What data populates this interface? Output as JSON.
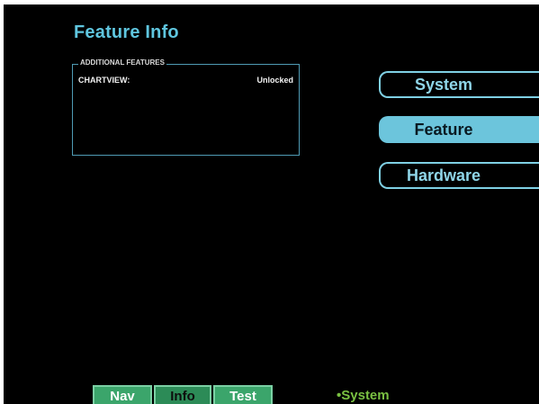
{
  "page": {
    "title": "Feature Info"
  },
  "additional_features": {
    "legend": "ADDITIONAL FEATURES",
    "items": [
      {
        "name": "CHARTVIEW:",
        "status": "Unlocked"
      }
    ]
  },
  "side_menu": {
    "system_label": "System",
    "feature_label": "Feature",
    "hardware_label": "Hardware",
    "active": "Feature"
  },
  "bottom_tabs": {
    "nav_label": "Nav",
    "info_label": "Info",
    "test_label": "Test",
    "active": "Info"
  },
  "status": {
    "text": "•System"
  },
  "colors": {
    "background": "#000000",
    "title": "#5fc6df",
    "button_border": "#7fd0e4",
    "active_button": "#6cc5dc",
    "tab_green": "#3ba56b",
    "status_green": "#7ac142"
  }
}
